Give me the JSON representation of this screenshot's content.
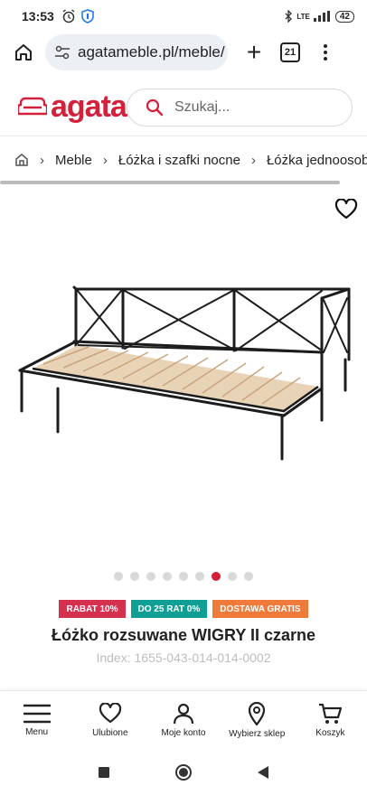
{
  "status_bar": {
    "time": "13:53",
    "network": "LTE",
    "battery": "42"
  },
  "browser": {
    "url": "agatameble.pl/meble/",
    "tab_count": "21"
  },
  "site": {
    "logo_text": "agata",
    "brand_color": "#d3203b",
    "search_placeholder": "Szukaj..."
  },
  "breadcrumb": {
    "items": [
      "Meble",
      "Łóżka i szafki nocne",
      "Łóżka jednoosobowe"
    ]
  },
  "gallery": {
    "dot_count": 9,
    "active_dot": 6
  },
  "badges": [
    {
      "label": "RABAT 10%",
      "color": "#d6304f"
    },
    {
      "label": "DO 25 RAT 0%",
      "color": "#109f95"
    },
    {
      "label": "DOSTAWA GRATIS",
      "color": "#f07a3a"
    }
  ],
  "product": {
    "title": "Łóżko rozsuwane WIGRY II czarne",
    "index": "Index: 1655-043-014-014-0002"
  },
  "bottom_nav": {
    "menu": "Menu",
    "favorites": "Ulubione",
    "account": "Moje konto",
    "store": "Wybierz sklep",
    "cart": "Koszyk"
  }
}
